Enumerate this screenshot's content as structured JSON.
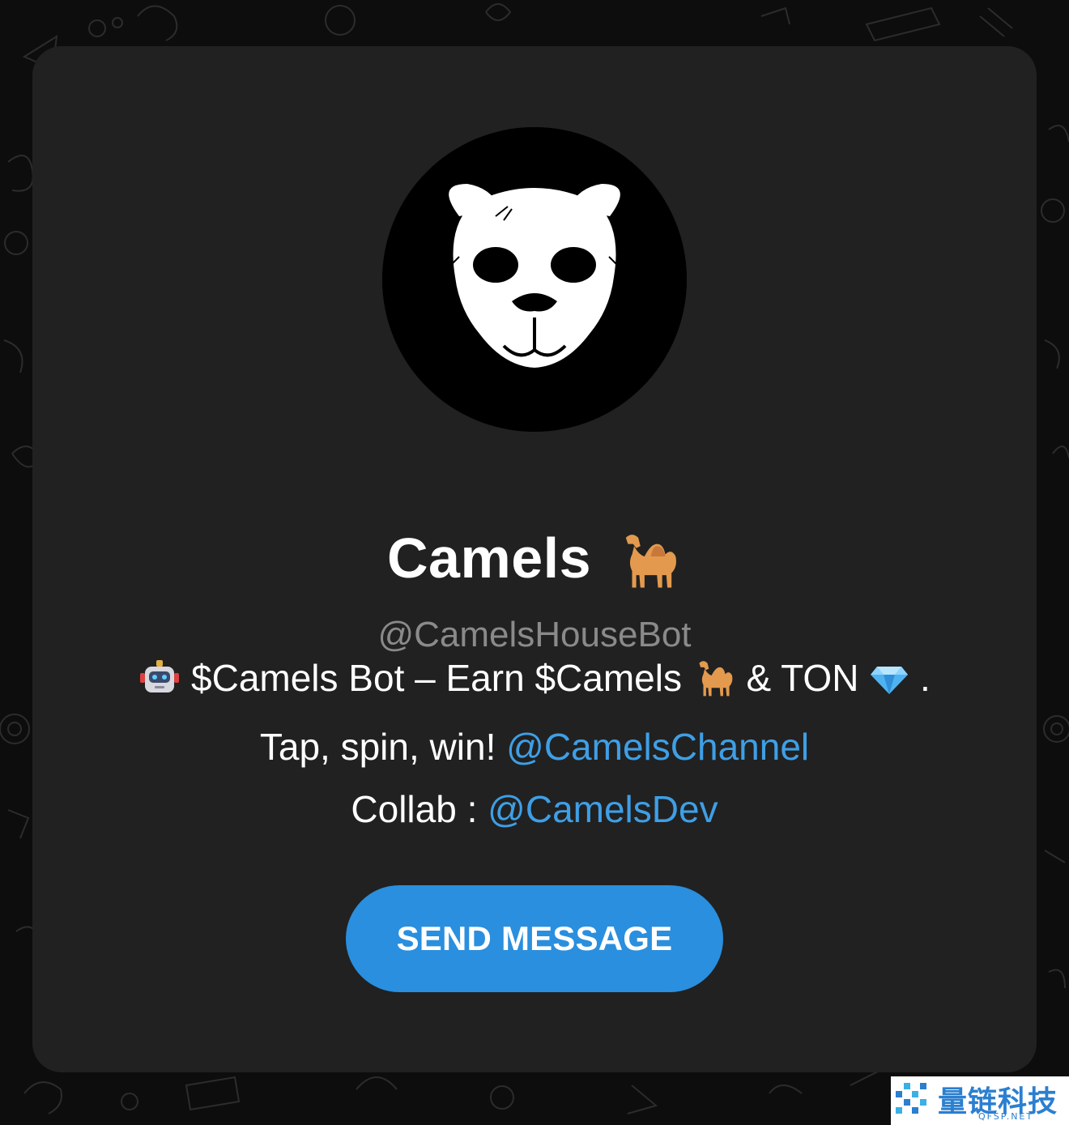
{
  "profile": {
    "name": "Camels",
    "name_emoji": "camel-emoji",
    "username": "@CamelsHouseBot"
  },
  "bio": {
    "line1": {
      "emoji_start": "robot-emoji",
      "text_a": "$Camels Bot – Earn $Camels",
      "emoji_mid": "camel-emoji",
      "text_b": "& TON",
      "emoji_end": "gem-emoji",
      "text_c": "."
    },
    "line2": {
      "text": "Tap, spin, win!",
      "link": "@CamelsChannel"
    },
    "line3": {
      "text": "Collab :",
      "link": "@CamelsDev"
    }
  },
  "actions": {
    "send_message": "SEND MESSAGE"
  },
  "watermark": {
    "text": "量链科技",
    "subtext": "QFSP.NET"
  },
  "colors": {
    "background": "#0d0d0d",
    "card": "#212121",
    "link": "#3e9fe6",
    "button": "#2a8fde",
    "username": "#8a8a8a"
  }
}
